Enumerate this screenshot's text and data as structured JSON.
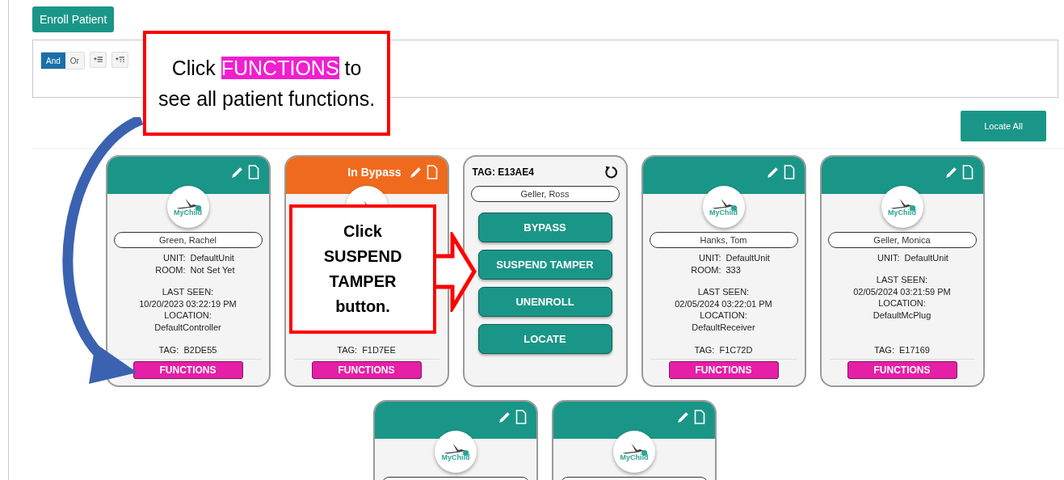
{
  "enroll_button": "Enroll Patient",
  "filter": {
    "operators": [
      {
        "label": "And",
        "selected": true
      },
      {
        "label": "Or",
        "selected": false
      }
    ]
  },
  "locate_all_button": "Locate All",
  "card_rows": [
    [
      {
        "kind": "patient",
        "in_bypass": false,
        "logo": "MyChild",
        "name": "Green, Rachel",
        "fields": [
          {
            "label": "UNIT:",
            "value": "DefaultUnit"
          },
          {
            "label": "ROOM:",
            "value": "Not Set Yet"
          }
        ],
        "last_seen_label": "LAST SEEN:",
        "last_seen": "10/20/2023 03:22:19 PM",
        "location_label": "LOCATION:",
        "location": "DefaultController",
        "tag_label": "TAG:",
        "tag": "B2DE55",
        "functions_button": "FUNCTIONS"
      },
      {
        "kind": "patient",
        "in_bypass": true,
        "status": "In Bypass",
        "tag_label": "TAG:",
        "tag": "F1D7EE",
        "functions_button": "FUNCTIONS"
      },
      {
        "kind": "functions",
        "title": "TAG: E13AE4",
        "name": "Geller, Ross",
        "actions": [
          "BYPASS",
          "SUSPEND TAMPER",
          "UNENROLL",
          "LOCATE"
        ]
      },
      {
        "kind": "patient",
        "in_bypass": false,
        "logo": "MyChild",
        "name": "Hanks, Tom",
        "fields": [
          {
            "label": "UNIT:",
            "value": "DefaultUnit"
          },
          {
            "label": "ROOM:",
            "value": "333"
          }
        ],
        "last_seen_label": "LAST SEEN:",
        "last_seen": "02/05/2024 03:22:01 PM",
        "location_label": "LOCATION:",
        "location": "DefaultReceiver",
        "tag_label": "TAG:",
        "tag": "F1C72D",
        "functions_button": "FUNCTIONS"
      },
      {
        "kind": "patient",
        "in_bypass": false,
        "logo": "MyChild",
        "name": "Geller, Monica",
        "fields": [
          {
            "label": "UNIT:",
            "value": "DefaultUnit"
          }
        ],
        "last_seen_label": "LAST SEEN:",
        "last_seen": "02/05/2024 03:21:59 PM",
        "location_label": "LOCATION:",
        "location": "DefaultMcPlug",
        "tag_label": "TAG:",
        "tag": "E17169",
        "functions_button": "FUNCTIONS"
      }
    ],
    [
      {
        "kind": "patient",
        "in_bypass": false,
        "logo": "MyChild"
      },
      {
        "kind": "patient",
        "in_bypass": false,
        "logo": "MyChild"
      }
    ]
  ],
  "callouts": [
    {
      "kind": "note",
      "text": "Click **FUNCTIONS** to see all patient functions."
    },
    {
      "kind": "pointer",
      "text": "Click SUSPEND TAMPER button."
    }
  ]
}
